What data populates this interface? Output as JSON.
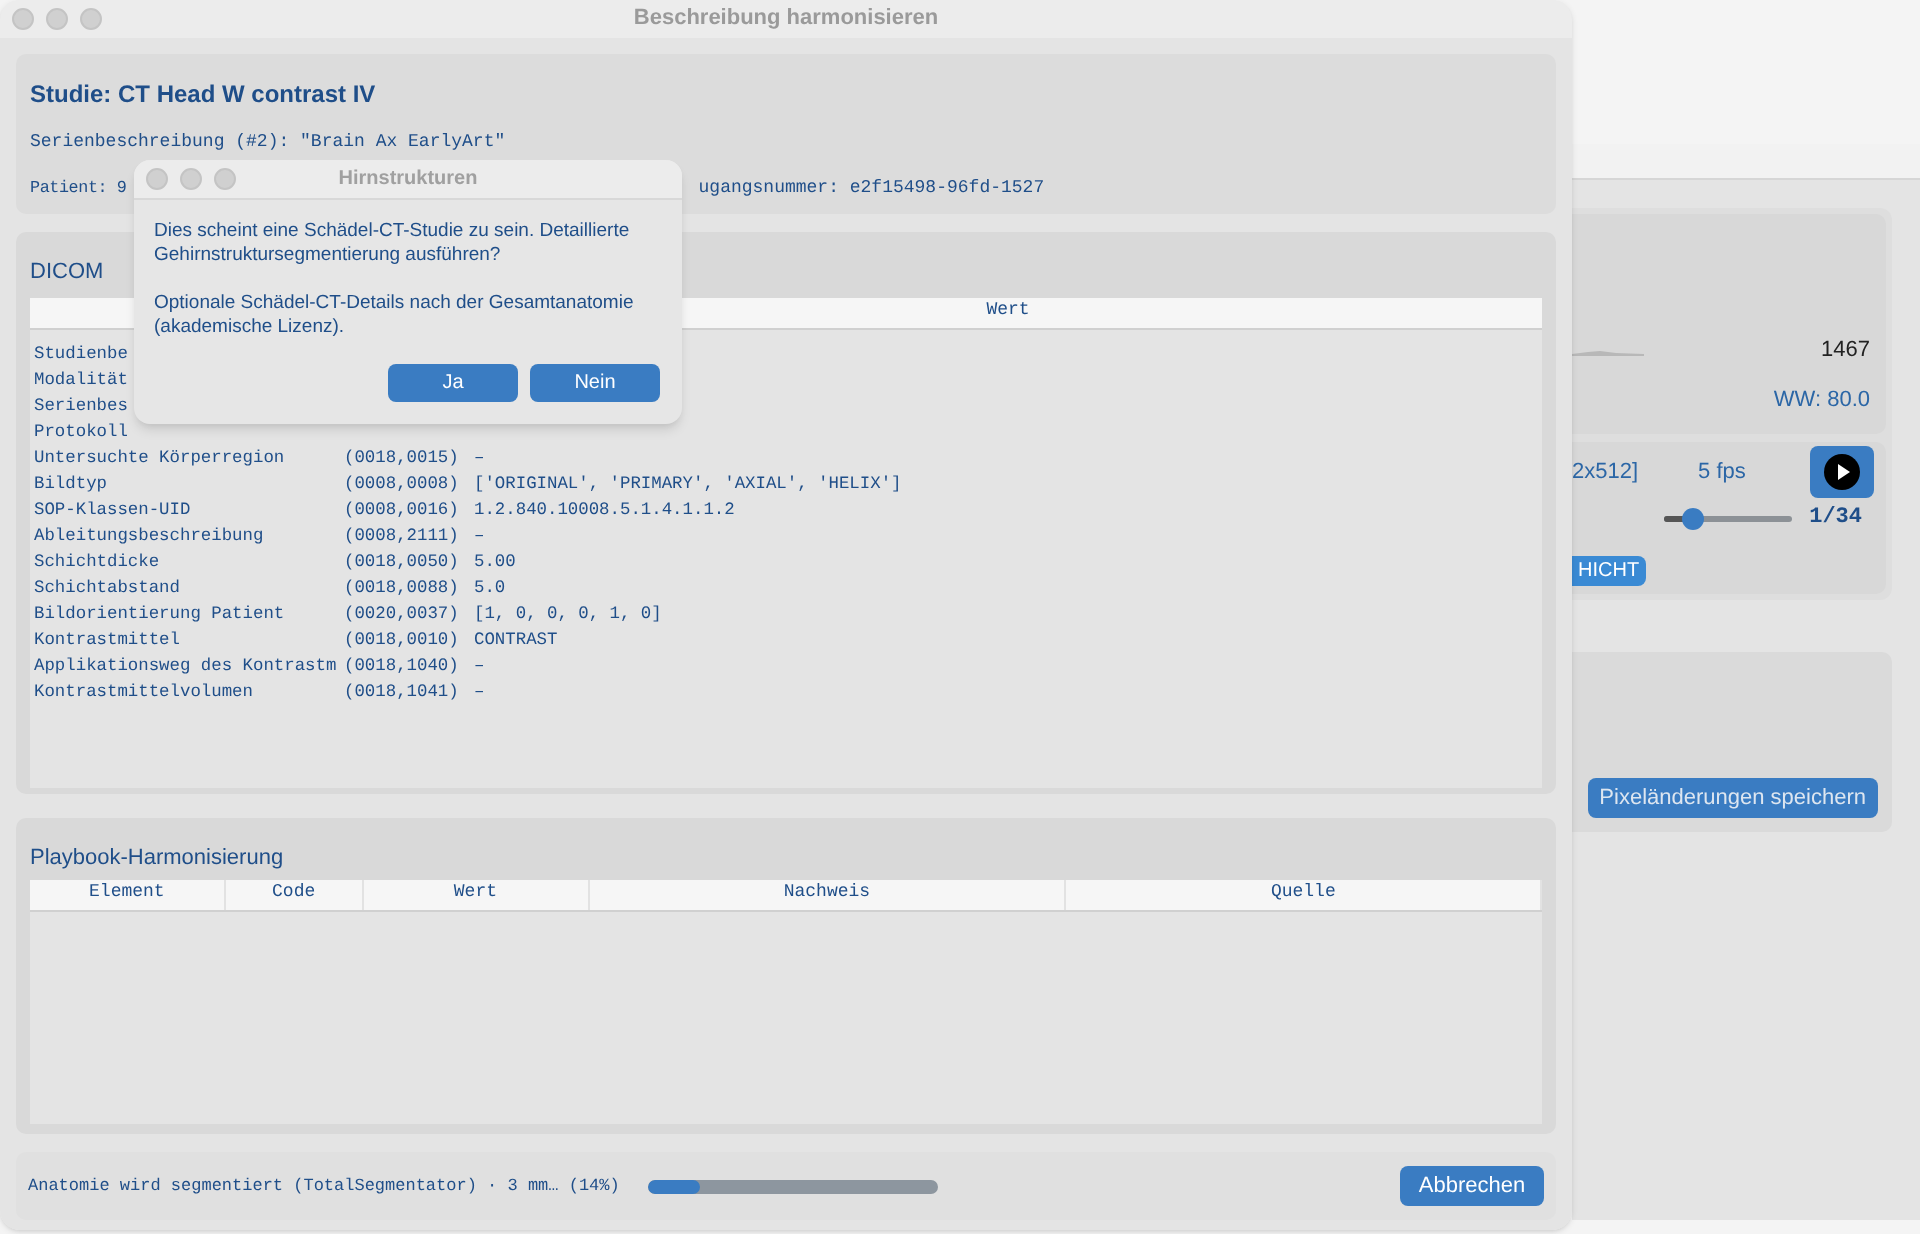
{
  "window": {
    "title": "Beschreibung harmonisieren"
  },
  "study": {
    "title": "Studie: CT Head W contrast IV",
    "series": "Serienbeschreibung (#2): \"Brain Ax EarlyArt\"",
    "patient": "Patient: 9",
    "accession": "ugangsnummer: e2f15498-96fd-1527"
  },
  "dicom": {
    "label": "DICOM",
    "columns": [
      "",
      "Wert"
    ],
    "rows": [
      {
        "name": "Studienbe",
        "tag": "",
        "value": ""
      },
      {
        "name": "Modalität",
        "tag": "",
        "value": ""
      },
      {
        "name": "Serienbes",
        "tag": "",
        "value": ""
      },
      {
        "name": "Protokoll",
        "tag": "",
        "value": ""
      },
      {
        "name": "Untersuchte Körperregion",
        "tag": "(0018,0015)",
        "value": "–"
      },
      {
        "name": "Bildtyp",
        "tag": "(0008,0008)",
        "value": "['ORIGINAL', 'PRIMARY', 'AXIAL', 'HELIX']"
      },
      {
        "name": "SOP-Klassen-UID",
        "tag": "(0008,0016)",
        "value": "1.2.840.10008.5.1.4.1.1.2"
      },
      {
        "name": "Ableitungsbeschreibung",
        "tag": "(0008,2111)",
        "value": "–"
      },
      {
        "name": "Schichtdicke",
        "tag": "(0018,0050)",
        "value": "5.00"
      },
      {
        "name": "Schichtabstand",
        "tag": "(0018,0088)",
        "value": "5.0"
      },
      {
        "name": "Bildorientierung Patient",
        "tag": "(0020,0037)",
        "value": "[1, 0, 0, 0, 1, 0]"
      },
      {
        "name": "Kontrastmittel",
        "tag": "(0018,0010)",
        "value": "CONTRAST"
      },
      {
        "name": "Applikationsweg des Kontrastm",
        "tag": "(0018,1040)",
        "value": "–"
      },
      {
        "name": "Kontrastmittelvolumen",
        "tag": "(0018,1041)",
        "value": "–"
      }
    ]
  },
  "playbook": {
    "label": "Playbook-Harmonisierung",
    "columns": [
      "Element",
      "Code",
      "Wert",
      "Nachweis",
      "Quelle"
    ]
  },
  "status_bar": {
    "text": "Anatomie wird segmentiert (TotalSegmentator) · 3 mm… (14%)",
    "progress": {
      "level": 0.18
    },
    "button": "Abbrechen"
  },
  "dialog": {
    "title": "Hirnstrukturen",
    "message": "Dies scheint eine Schädel-CT-Studie zu sein. Detaillierte Gehirnstruktursegmentierung ausführen?",
    "note": "Optionale Schädel-CT-Details nach der Gesamtanatomie (akademische Lizenz).",
    "buttons": [
      "Ja",
      "Nein"
    ]
  },
  "viewer": {
    "max": "1467",
    "window_width": "WW: 80.0",
    "matrix": "2x512]",
    "fps": "5 fps",
    "frame": "1/34",
    "slider": {
      "level": 0.22
    },
    "layer_button": "HICHT",
    "save_button": "Pixeländerungen speichern"
  }
}
